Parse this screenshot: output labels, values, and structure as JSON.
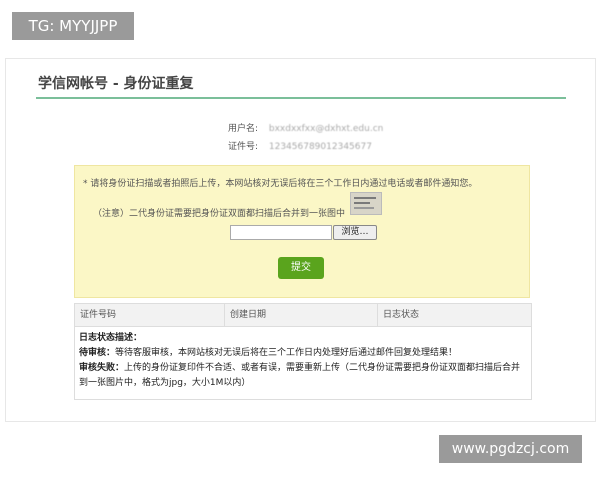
{
  "watermark_top": "TG: MYYJJPP",
  "watermark_bottom": "www.pgdzcj.com",
  "page": {
    "title": "学信网帐号 - 身份证重复"
  },
  "info": {
    "username_label": "用户名:",
    "username_value": "bxxdxxfxx@dxhxt.edu.cn",
    "id_label": "证件号:",
    "id_value": "123456789012345677"
  },
  "notice": {
    "line1": "* 请将身份证扫描或者拍照后上传，本网站核对无误后将在三个工作日内通过电话或者邮件通知您。",
    "line2": "（注意）二代身份证需要把身份证双面都扫描后合并到一张图中",
    "browse_label": "浏览…",
    "submit_label": "提交"
  },
  "log": {
    "columns": [
      "证件号码",
      "创建日期",
      "日志状态"
    ],
    "desc_heading": "日志状态描述：",
    "pending_label": "待审核：",
    "pending_text": "等待客服审核，本网站核对无误后将在三个工作日内处理好后通过邮件回复处理结果！",
    "fail_label": "审核失败：",
    "fail_text": "上传的身份证复印件不合适、或者有误，需要重新上传（二代身份证需要把身份证双面都扫描后合并到一张图片中，格式为jpg，大小1M以内）"
  }
}
